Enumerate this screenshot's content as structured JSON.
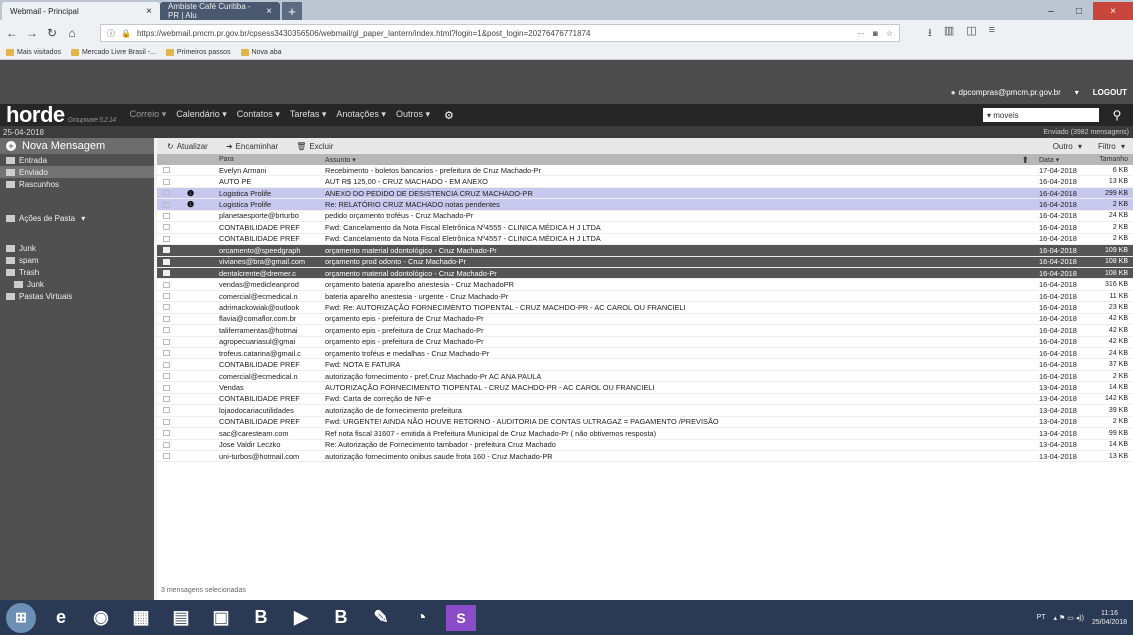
{
  "browser": {
    "tabs": [
      {
        "label": "Webmail - Principal",
        "active": true
      },
      {
        "label": "Ambiste Café Curitiba - PR | Alu",
        "active": false
      }
    ],
    "url": "https://webmail.pmcm.pr.gov.br/cpsess3430356506/webmail/gl_paper_lantern/index.html?login=1&post_login=20276476771874",
    "bookmarks": [
      "Mais visitados",
      "Mercado Livre Brasil -...",
      "Primeiros passos",
      "Nova aba"
    ]
  },
  "app": {
    "user": "dpcompras@pmcm.pr.gov.br",
    "logout": "LOGOUT",
    "logo": "horde",
    "logo_version": "Groupware 5.2.14",
    "menu": [
      "Correio",
      "Calendário",
      "Contatos",
      "Tarefas",
      "Anotações",
      "Outros"
    ],
    "search_value": "moveis",
    "date": "25-04-2018",
    "folder_info": "Enviado (3982 mensagens)"
  },
  "sidebar": {
    "new_message": "Nova Mensagem",
    "folders": [
      "Entrada",
      "Enviado",
      "Rascunhos"
    ],
    "actions": "Ações de Pasta",
    "extra_folders": [
      "Junk",
      "spam",
      "Trash",
      "Junk",
      "Pastas Virtuais"
    ]
  },
  "toolbar": {
    "refresh": "Atualizar",
    "forward": "Encaminhar",
    "delete": "Excluir",
    "other": "Outro",
    "filter": "Filtro"
  },
  "columns": {
    "to": "Para",
    "subject": "Assunto",
    "date": "Data",
    "size": "Tamanho"
  },
  "messages": [
    {
      "to": "Evelyn Armani",
      "subject": "Recebimento - boletos bancarios - prefeitura de Cruz Machado-Pr",
      "date": "17-04-2018",
      "size": "6 KB"
    },
    {
      "to": "AUTO PE",
      "subject": "AUT R$ 125,00 - CRUZ MACHADO - EM ANEXO",
      "date": "16-04-2018",
      "size": "13 KB"
    },
    {
      "to": "Logistica Prolife",
      "subject": "ANEXO DO PEDIDO DE DESISTENCIA CRUZ MACHADO-PR",
      "date": "16-04-2018",
      "size": "299 KB"
    },
    {
      "to": "Logistica Prolife",
      "subject": "Re: RELATÓRIO CRUZ MACHADO notas pendentes",
      "date": "16-04-2018",
      "size": "2 KB"
    },
    {
      "to": "planetaesporte@brturbo",
      "subject": "pedido orçamento troféus - Cruz Machado-Pr",
      "date": "16-04-2018",
      "size": "24 KB"
    },
    {
      "to": "CONTABILIDADE PREF",
      "subject": "Fwd: Cancelamento da Nota Fiscal Eletrônica Nº4555 - CLINICA MÉDICA H J LTDA",
      "date": "16-04-2018",
      "size": "2 KB"
    },
    {
      "to": "CONTABILIDADE PREF",
      "subject": "Fwd: Cancelamento da Nota Fiscal Eletrônica Nº4557 - CLINICA MÉDICA H J LTDA",
      "date": "16-04-2018",
      "size": "2 KB"
    },
    {
      "to": "orcamento@speedgraph",
      "subject": "orçamento material odontológico - Cruz Machado-Pr",
      "date": "16-04-2018",
      "size": "109 KB"
    },
    {
      "to": "vivianes@bra@gmail.com",
      "subject": "orçamento prod odonto - Cruz Machado-Pr",
      "date": "16-04-2018",
      "size": "108 KB"
    },
    {
      "to": "dentalcrente@dremer.c",
      "subject": "orçamento material odontológico - Cruz Machado-Pr",
      "date": "16-04-2018",
      "size": "108 KB"
    },
    {
      "to": "vendas@medicleanprod",
      "subject": "orçamento bateria aparelho anestesia - Cruz MachadoPR",
      "date": "16-04-2018",
      "size": "316 KB"
    },
    {
      "to": "comercial@ecmedical.n",
      "subject": "bateria aparelho anestesia - urgente - Cruz Machado-Pr",
      "date": "16-04-2018",
      "size": "11 KB"
    },
    {
      "to": "adrimackowiak@outlook",
      "subject": "Fwd: Re: AUTORIZAÇÃO FORNECIMENTO TIOPENTAL - CRUZ MACHDO-PR - AC CAROL OU FRANCIELI",
      "date": "16-04-2018",
      "size": "23 KB"
    },
    {
      "to": "flavia@comaflor.com.br",
      "subject": "orçamento epis - prefeitura de Cruz Machado-Pr",
      "date": "16-04-2018",
      "size": "42 KB"
    },
    {
      "to": "taliferramentas@hotmai",
      "subject": "orçamento epis - prefeitura de Cruz Machado-Pr",
      "date": "16-04-2018",
      "size": "42 KB"
    },
    {
      "to": "agropecuariasul@gmai",
      "subject": "orçamento epis - prefeitura de Cruz Machado-Pr",
      "date": "16-04-2018",
      "size": "42 KB"
    },
    {
      "to": "trofeus.catarina@gmail.c",
      "subject": "orçamento troféus e medalhas - Cruz Machado-Pr",
      "date": "16-04-2018",
      "size": "24 KB"
    },
    {
      "to": "CONTABILIDADE PREF",
      "subject": "Fwd: NOTA E FATURA",
      "date": "16-04-2018",
      "size": "37 KB"
    },
    {
      "to": "comercial@ecmedical.n",
      "subject": "autorização fornecimento - pref.Cruz Machado-Pr AC ANA PAULA",
      "date": "16-04-2018",
      "size": "2 KB"
    },
    {
      "to": "Vendas",
      "subject": "AUTORIZAÇÃO FORNECIMENTO TIOPENTAL - CRUZ MACHDO-PR - AC CAROL OU FRANCIELI",
      "date": "13-04-2018",
      "size": "14 KB"
    },
    {
      "to": "CONTABILIDADE PREF",
      "subject": "Fwd: Carta de correção de NF-e",
      "date": "13-04-2018",
      "size": "142 KB"
    },
    {
      "to": "lojaodocariacutilidades",
      "subject": "autorização de de fornecimento prefeitura",
      "date": "13-04-2018",
      "size": "39 KB"
    },
    {
      "to": "CONTABILIDADE PREF",
      "subject": "Fwd: URGENTE! AINDA NÃO HOUVE RETORNO - AUDITORIA DE CONTAS ULTRAGAZ = PAGAMENTO /PREVISÃO",
      "date": "13-04-2018",
      "size": "2 KB"
    },
    {
      "to": "sac@caresteam.com",
      "subject": "Ref nota fiscal 31607 - emitida à Prefeitura Municipal de Cruz Machado-Pr ( não obtivemos resposta)",
      "date": "13-04-2018",
      "size": "99 KB"
    },
    {
      "to": "Jose Valdir Leczko",
      "subject": "Re: Autorização de Fornecimento tambador - prefeitura Cruz Machado",
      "date": "13-04-2018",
      "size": "14 KB"
    },
    {
      "to": "uni-turbos@hotmail.com",
      "subject": "autorização fornecimento onibus saude frota 160 - Cruz Machado-PR",
      "date": "13-04-2018",
      "size": "13 KB"
    }
  ],
  "footer": "3 mensagens selecionadas",
  "taskbar": {
    "time": "11:16",
    "date": "25/04/2018",
    "lang": "PT"
  }
}
